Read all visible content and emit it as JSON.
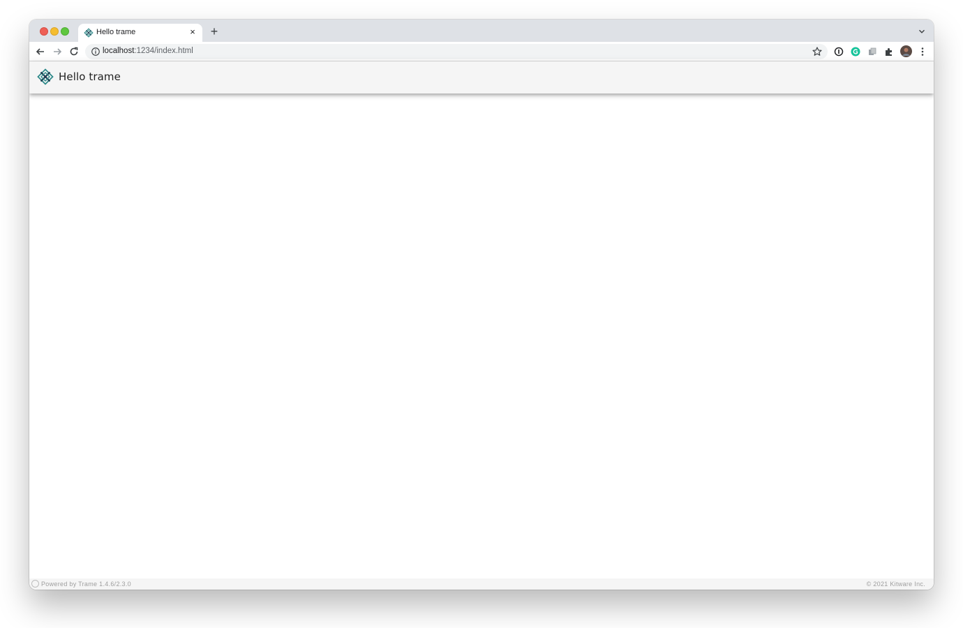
{
  "browser": {
    "tab": {
      "title": "Hello trame",
      "close_glyph": "×",
      "favicon": "trame-logo-icon"
    },
    "new_tab_glyph": "+",
    "address_bar": {
      "host": "localhost",
      "path": ":1234/index.html"
    },
    "icons": [
      "back-arrow-icon",
      "forward-arrow-icon",
      "reload-icon",
      "site-info-icon",
      "bookmark-star-icon",
      "password-extension-icon",
      "grammarly-extension-icon",
      "extension-icon",
      "extensions-puzzle-icon",
      "profile-avatar",
      "more-menu-icon",
      "tab-list-chevron-icon"
    ]
  },
  "app": {
    "title": "Hello trame",
    "logo": "trame-logo-icon"
  },
  "footer": {
    "powered_by": "Powered by Trame 1.4.6/2.3.0",
    "copyright": "© 2021 Kitware Inc."
  },
  "colors": {
    "header_bg": "#f5f5f5",
    "logo_teal": "#2f8a8a",
    "logo_dark": "#1b3b4f"
  }
}
